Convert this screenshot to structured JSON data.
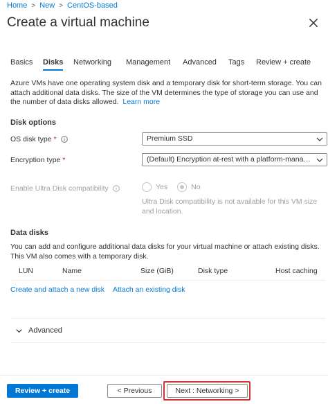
{
  "breadcrumb": {
    "items": [
      "Home",
      "New",
      "CentOS-based"
    ],
    "separator": ">"
  },
  "page_title": "Create a virtual machine",
  "tabs": [
    {
      "label": "Basics",
      "active": false
    },
    {
      "label": "Disks",
      "active": true
    },
    {
      "label": "Networking",
      "active": false
    },
    {
      "label": "Management",
      "active": false
    },
    {
      "label": "Advanced",
      "active": false
    },
    {
      "label": "Tags",
      "active": false
    },
    {
      "label": "Review + create",
      "active": false
    }
  ],
  "intro": {
    "text": "Azure VMs have one operating system disk and a temporary disk for short-term storage. You can attach additional data disks. The size of the VM determines the type of storage you can use and the number of data disks allowed.",
    "link": "Learn more"
  },
  "disk_options": {
    "heading": "Disk options",
    "os_disk_type": {
      "label": "OS disk type",
      "required": "*",
      "value": "Premium SSD"
    },
    "encryption_type": {
      "label": "Encryption type",
      "required": "*",
      "value": "(Default) Encryption at-rest with a platform-manage..."
    },
    "ultra_disk": {
      "label": "Enable Ultra Disk compatibility",
      "options": [
        "Yes",
        "No"
      ],
      "selected": "No",
      "note": "Ultra Disk compatibility is not available for this VM size and location."
    }
  },
  "data_disks": {
    "heading": "Data disks",
    "description": "You can add and configure additional data disks for your virtual machine or attach existing disks. This VM also comes with a temporary disk.",
    "columns": [
      "LUN",
      "Name",
      "Size (GiB)",
      "Disk type",
      "Host caching"
    ],
    "create_link": "Create and attach a new disk",
    "attach_link": "Attach an existing disk"
  },
  "advanced": {
    "label": "Advanced"
  },
  "footer": {
    "review_create": "Review + create",
    "previous": "< Previous",
    "next": "Next : Networking >"
  },
  "colors": {
    "accent": "#0078d4",
    "highlight": "#d13438",
    "required": "#a4262c"
  },
  "icons": {
    "close": "close-icon",
    "info": "info-icon",
    "dropdown": "chevron-down-icon",
    "collapse": "chevron-down-icon"
  }
}
